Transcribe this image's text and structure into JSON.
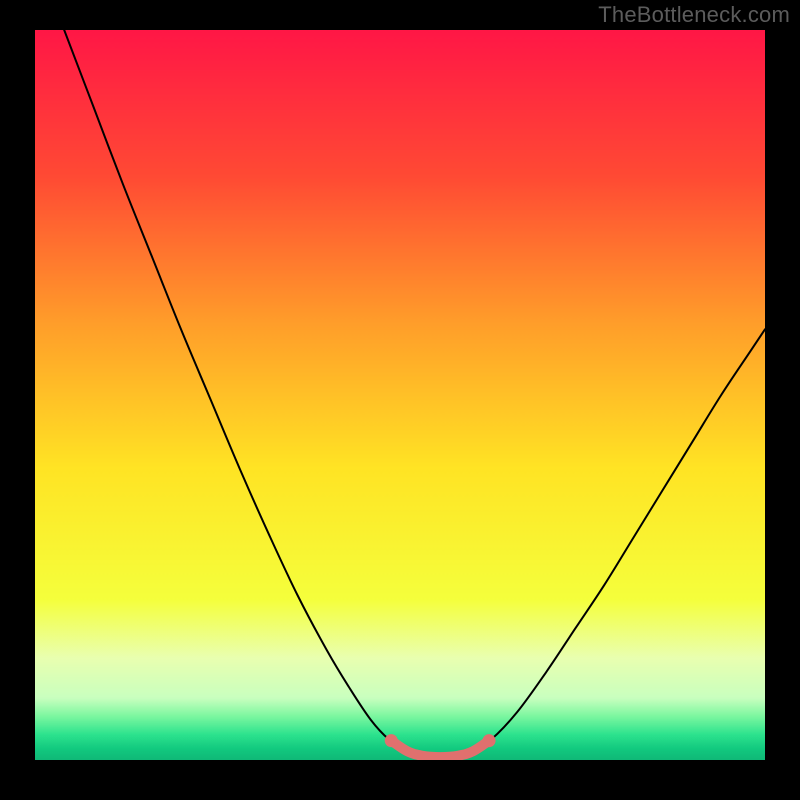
{
  "watermark": "TheBottleneck.com",
  "chart_data": {
    "type": "line",
    "title": "",
    "xlabel": "",
    "ylabel": "",
    "xlim": [
      0,
      1
    ],
    "ylim": [
      0,
      1
    ],
    "gradient_stops": [
      {
        "t": 0.0,
        "color": "#ff1746"
      },
      {
        "t": 0.2,
        "color": "#ff4a34"
      },
      {
        "t": 0.4,
        "color": "#ff9d2a"
      },
      {
        "t": 0.6,
        "color": "#ffe424"
      },
      {
        "t": 0.78,
        "color": "#f5ff3c"
      },
      {
        "t": 0.86,
        "color": "#e9ffb0"
      },
      {
        "t": 0.915,
        "color": "#c9ffbf"
      },
      {
        "t": 0.94,
        "color": "#7cf7a0"
      },
      {
        "t": 0.965,
        "color": "#2de38e"
      },
      {
        "t": 0.985,
        "color": "#12c97f"
      },
      {
        "t": 1.0,
        "color": "#0fb877"
      }
    ],
    "series": [
      {
        "name": "bottleneck-curve",
        "color": "#000000",
        "points": [
          {
            "x": 0.04,
            "y": 1.0
          },
          {
            "x": 0.08,
            "y": 0.895
          },
          {
            "x": 0.12,
            "y": 0.79
          },
          {
            "x": 0.16,
            "y": 0.69
          },
          {
            "x": 0.2,
            "y": 0.59
          },
          {
            "x": 0.24,
            "y": 0.495
          },
          {
            "x": 0.28,
            "y": 0.4
          },
          {
            "x": 0.32,
            "y": 0.31
          },
          {
            "x": 0.36,
            "y": 0.225
          },
          {
            "x": 0.4,
            "y": 0.15
          },
          {
            "x": 0.43,
            "y": 0.1
          },
          {
            "x": 0.46,
            "y": 0.055
          },
          {
            "x": 0.485,
            "y": 0.028
          },
          {
            "x": 0.51,
            "y": 0.012
          },
          {
            "x": 0.53,
            "y": 0.006
          },
          {
            "x": 0.555,
            "y": 0.004
          },
          {
            "x": 0.58,
            "y": 0.006
          },
          {
            "x": 0.6,
            "y": 0.012
          },
          {
            "x": 0.625,
            "y": 0.028
          },
          {
            "x": 0.66,
            "y": 0.065
          },
          {
            "x": 0.7,
            "y": 0.12
          },
          {
            "x": 0.74,
            "y": 0.18
          },
          {
            "x": 0.78,
            "y": 0.24
          },
          {
            "x": 0.82,
            "y": 0.305
          },
          {
            "x": 0.86,
            "y": 0.37
          },
          {
            "x": 0.9,
            "y": 0.435
          },
          {
            "x": 0.94,
            "y": 0.5
          },
          {
            "x": 0.98,
            "y": 0.56
          },
          {
            "x": 1.0,
            "y": 0.59
          }
        ]
      },
      {
        "name": "highlight-segment",
        "color": "#e0706e",
        "width": 10,
        "points": [
          {
            "x": 0.488,
            "y": 0.0265
          },
          {
            "x": 0.51,
            "y": 0.012
          },
          {
            "x": 0.53,
            "y": 0.006
          },
          {
            "x": 0.555,
            "y": 0.004
          },
          {
            "x": 0.58,
            "y": 0.006
          },
          {
            "x": 0.6,
            "y": 0.012
          },
          {
            "x": 0.622,
            "y": 0.0265
          }
        ],
        "end_dots": [
          {
            "x": 0.488,
            "y": 0.0265
          },
          {
            "x": 0.622,
            "y": 0.0265
          }
        ]
      }
    ]
  }
}
